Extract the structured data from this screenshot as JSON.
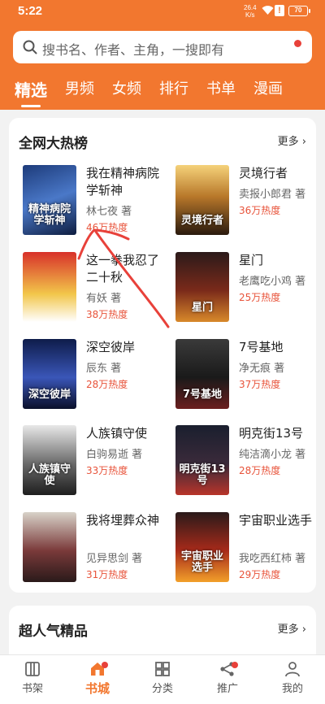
{
  "status": {
    "time": "5:22",
    "speed_value": "26.4",
    "speed_unit": "K/s",
    "alert": "!",
    "battery": "70"
  },
  "search": {
    "placeholder": "搜书名、作者、主角，一搜即有"
  },
  "tabs": [
    "精选",
    "男频",
    "女频",
    "排行",
    "书单",
    "漫画"
  ],
  "hot_list": {
    "title": "全网大热榜",
    "more": "更多",
    "books": [
      {
        "title": "我在精神病院学斩神",
        "author": "林七夜 著",
        "heat": "46万热度",
        "cover_text": "精神病院学斩神"
      },
      {
        "title": "灵境行者",
        "author": "卖报小郎君 著",
        "heat": "36万热度",
        "cover_text": "灵境行者"
      },
      {
        "title": "这一拳我忍了二十秋",
        "author": "有妖 著",
        "heat": "38万热度",
        "cover_text": ""
      },
      {
        "title": "星门",
        "author": "老鹰吃小鸡 著",
        "heat": "25万热度",
        "cover_text": "星门"
      },
      {
        "title": "深空彼岸",
        "author": "辰东 著",
        "heat": "28万热度",
        "cover_text": "深空彼岸"
      },
      {
        "title": "7号基地",
        "author": "净无痕 著",
        "heat": "37万热度",
        "cover_text": "7号基地"
      },
      {
        "title": "人族镇守使",
        "author": "白驹易逝 著",
        "heat": "33万热度",
        "cover_text": "人族镇守使"
      },
      {
        "title": "明克街13号",
        "author": "纯洁滴小龙 著",
        "heat": "28万热度",
        "cover_text": "明克街13号"
      },
      {
        "title": "我将埋葬众神",
        "author": "见异思剑 著",
        "heat": "31万热度",
        "cover_text": ""
      },
      {
        "title": "宇宙职业选手",
        "author": "我吃西红柿 著",
        "heat": "29万热度",
        "cover_text": "宇宙职业选手"
      }
    ]
  },
  "second_section": {
    "title": "超人气精品",
    "more": "更多"
  },
  "nav": [
    {
      "label": "书架",
      "icon": "bookshelf-icon"
    },
    {
      "label": "书城",
      "icon": "home-icon"
    },
    {
      "label": "分类",
      "icon": "category-icon"
    },
    {
      "label": "推广",
      "icon": "share-icon"
    },
    {
      "label": "我的",
      "icon": "user-icon"
    }
  ],
  "colors": {
    "accent": "#f2772f",
    "heat": "#e8533a",
    "annotation": "#e8413a"
  }
}
